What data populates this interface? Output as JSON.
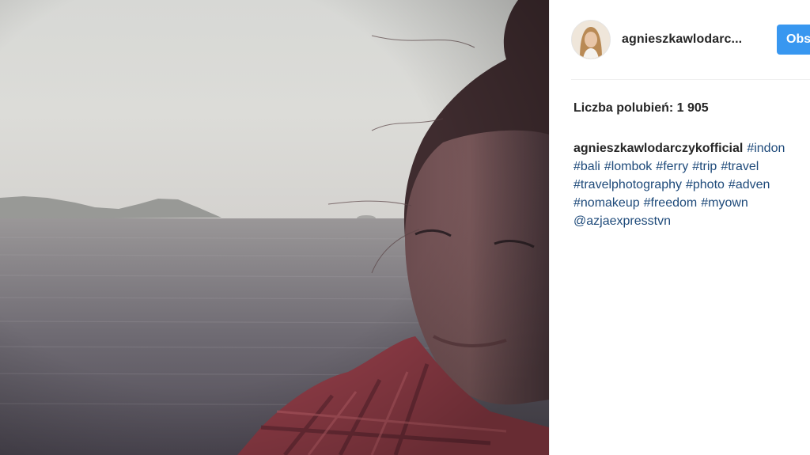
{
  "post": {
    "username": "agnieszkawlodarc...",
    "follow_label": "Obs",
    "likes_text": "Liczba polubień: 1 905",
    "caption_author": "agnieszkawlodarczykofficial",
    "tags_line1": [
      "#indon"
    ],
    "tags_line2": [
      "#bali",
      "#lombok",
      "#ferry",
      "#trip",
      "#travel"
    ],
    "tags_line3": [
      "#travelphotography",
      "#photo",
      "#adven"
    ],
    "tags_line4": [
      "#nomakeup",
      "#freedom",
      "#myown"
    ],
    "tags_line5": [
      "@azjaexpresstvn"
    ]
  },
  "colors": {
    "follow_button": "#3897f0",
    "tag_link": "#1e4a7a",
    "text": "#262626"
  },
  "icons": {
    "avatar": "profile-photo"
  }
}
